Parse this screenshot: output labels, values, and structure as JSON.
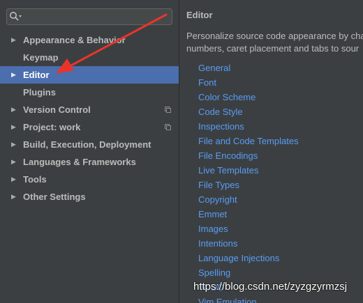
{
  "search": {
    "placeholder": "",
    "value": ""
  },
  "sidebar": {
    "items": [
      {
        "label": "Appearance & Behavior",
        "has_arrow": true,
        "selected": false,
        "project_icon": false
      },
      {
        "label": "Keymap",
        "has_arrow": false,
        "selected": false,
        "project_icon": false
      },
      {
        "label": "Editor",
        "has_arrow": true,
        "selected": true,
        "project_icon": false
      },
      {
        "label": "Plugins",
        "has_arrow": false,
        "selected": false,
        "project_icon": false
      },
      {
        "label": "Version Control",
        "has_arrow": true,
        "selected": false,
        "project_icon": true
      },
      {
        "label": "Project: work",
        "has_arrow": true,
        "selected": false,
        "project_icon": true
      },
      {
        "label": "Build, Execution, Deployment",
        "has_arrow": true,
        "selected": false,
        "project_icon": false
      },
      {
        "label": "Languages & Frameworks",
        "has_arrow": true,
        "selected": false,
        "project_icon": false
      },
      {
        "label": "Tools",
        "has_arrow": true,
        "selected": false,
        "project_icon": false
      },
      {
        "label": "Other Settings",
        "has_arrow": true,
        "selected": false,
        "project_icon": false
      }
    ]
  },
  "main": {
    "title": "Editor",
    "description_lines": [
      "Personalize source code appearance by cha",
      "numbers, caret placement and tabs to sour"
    ],
    "links": [
      "General",
      "Font",
      "Color Scheme",
      "Code Style",
      "Inspections",
      "File and Code Templates",
      "File Encodings",
      "Live Templates",
      "File Types",
      "Copyright",
      "Emmet",
      "Images",
      "Intentions",
      "Language Injections",
      "Spelling",
      "TODO",
      "Vim Emulation"
    ]
  },
  "watermark": "https://blog.csdn.net/zyzgzyrmzsj",
  "colors": {
    "background": "#3c3f41",
    "selection": "#4b6eaf",
    "link": "#589df6",
    "text": "#bbbbbb",
    "annotation_arrow": "#e8352b"
  }
}
